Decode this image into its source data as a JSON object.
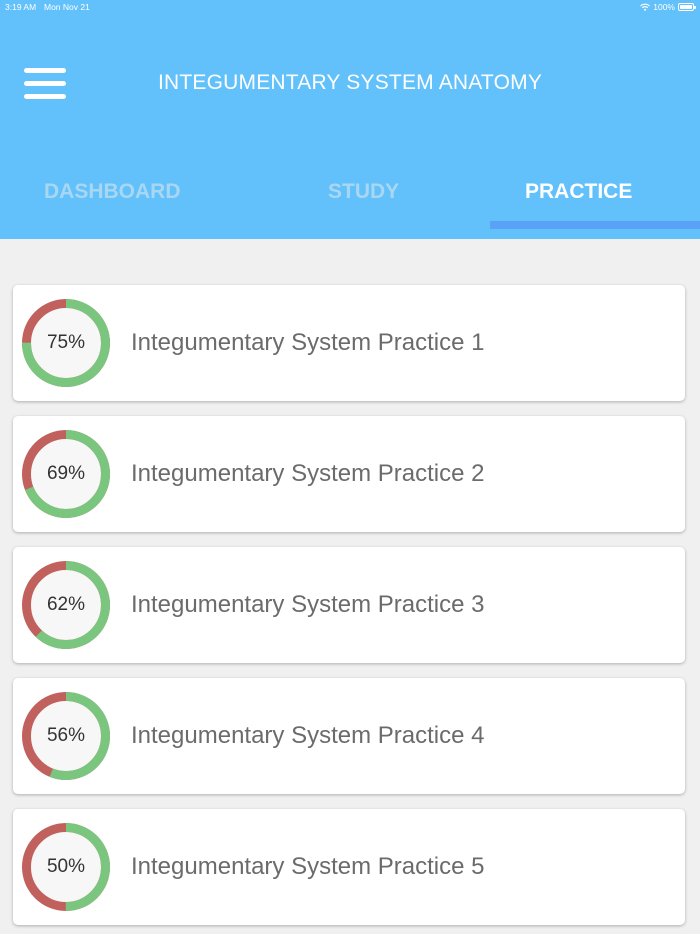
{
  "status_bar": {
    "time": "3:19 AM",
    "date": "Mon Nov 21",
    "battery": "100%"
  },
  "header": {
    "title": "INTEGUMENTARY SYSTEM ANATOMY",
    "background_color": "#62c0fa"
  },
  "tabs": [
    {
      "label": "DASHBOARD",
      "active": false
    },
    {
      "label": "STUDY",
      "active": false
    },
    {
      "label": "PRACTICE",
      "active": true
    }
  ],
  "colors": {
    "progress_done": "#7bc67e",
    "progress_remaining": "#c0615e",
    "indicator": "#5aa2f5"
  },
  "practices": [
    {
      "title": "Integumentary System Practice 1",
      "percent_label": "75%",
      "percent": 75
    },
    {
      "title": "Integumentary System Practice 2",
      "percent_label": "69%",
      "percent": 69
    },
    {
      "title": "Integumentary System Practice 3",
      "percent_label": "62%",
      "percent": 62
    },
    {
      "title": "Integumentary System Practice 4",
      "percent_label": "56%",
      "percent": 56
    },
    {
      "title": "Integumentary System Practice 5",
      "percent_label": "50%",
      "percent": 50
    }
  ]
}
